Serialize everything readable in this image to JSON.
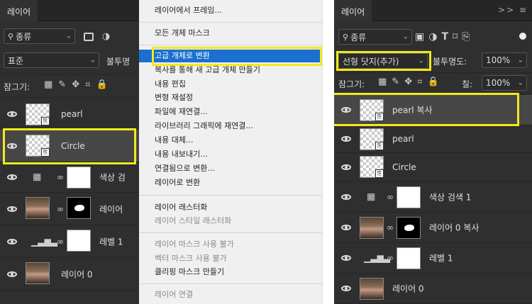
{
  "left_panel": {
    "tab": "레이어",
    "filter_label": "종류",
    "blend_mode": "표준",
    "opacity_label": "불투명",
    "lock_label": "잠그기:",
    "layers": [
      {
        "name": "pearl"
      },
      {
        "name": "Circle"
      },
      {
        "name": "색상 검"
      },
      {
        "name": "레이어"
      },
      {
        "name": "레벨 1"
      },
      {
        "name": "레이어 0"
      }
    ]
  },
  "context_menu": {
    "items": [
      {
        "label": "레이어에서 프레임..."
      },
      {
        "label": "모든 개체 마스크"
      },
      {
        "label": "고급 개체로 변환",
        "highlighted": true
      },
      {
        "label": "복사를 통해 새 고급 개체 만들기"
      },
      {
        "label": "내용 편집"
      },
      {
        "label": "변형 재설정"
      },
      {
        "label": "파일에 재연결..."
      },
      {
        "label": "라이브러리 그래픽에 재연결..."
      },
      {
        "label": "내용 대체..."
      },
      {
        "label": "내용 내보내기..."
      },
      {
        "label": "연결됨으로 변환..."
      },
      {
        "label": "레이어로 변환"
      },
      {
        "label": "레이어 래스터화"
      },
      {
        "label": "레이어 스타일 래스터화",
        "disabled": true
      },
      {
        "label": "레이어 마스크 사용 불가",
        "disabled": true
      },
      {
        "label": "벡터 마스크 사용 불가",
        "disabled": true
      },
      {
        "label": "클리핑 마스크 만들기"
      },
      {
        "label": "레이어 연결",
        "disabled": true
      }
    ]
  },
  "right_panel": {
    "tab": "레이어",
    "tab_icons": ">> ≡",
    "filter_label": "종류",
    "blend_mode": "선형 닷지(추가)",
    "opacity_label": "불투명도:",
    "opacity_value": "100%",
    "lock_label": "잠그기:",
    "fill_label": "칠:",
    "fill_value": "100%",
    "layers": [
      {
        "name": "pearl 복사"
      },
      {
        "name": "pearl"
      },
      {
        "name": "Circle"
      },
      {
        "name": "색상 검색 1"
      },
      {
        "name": "레이어 0 복사"
      },
      {
        "name": "레벨 1"
      },
      {
        "name": "레이어 0"
      }
    ]
  },
  "highlight_color": "#f2ea1b",
  "menu_highlight_color": "#1a6fd1"
}
